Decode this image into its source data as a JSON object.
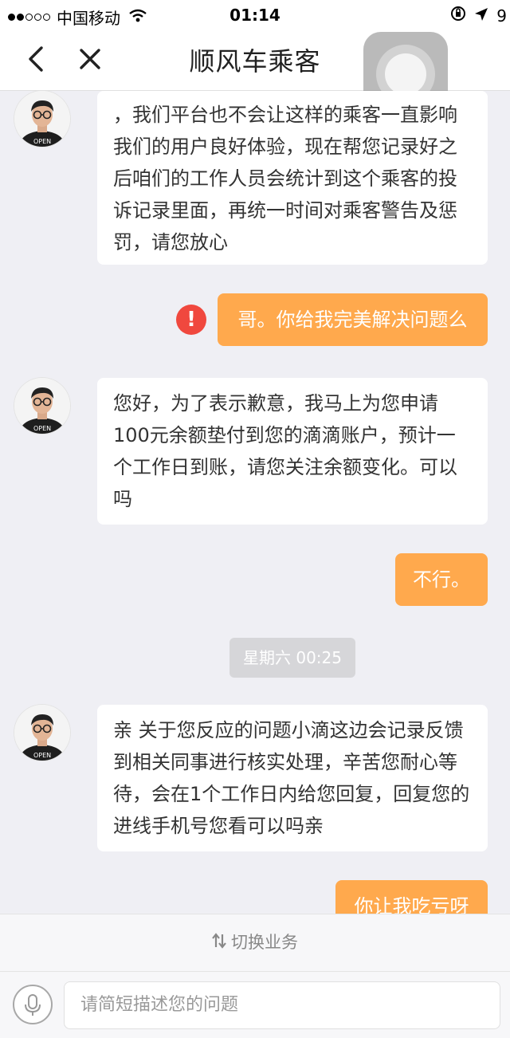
{
  "status_bar": {
    "carrier": "中国移动",
    "time": "01:14",
    "battery_fragment": "9"
  },
  "nav": {
    "title": "顺风车乘客"
  },
  "messages": [
    {
      "sender": "agent",
      "text": "，我们平台也不会让这样的乘客一直影响我们的用户良好体验，现在帮您记录好之后咱们的工作人员会统计到这个乘客的投诉记录里面，再统一时间对乘客警告及惩罚，请您放心"
    },
    {
      "sender": "user",
      "text": "哥。你给我完美解决问题么",
      "status_icon": "!"
    },
    {
      "sender": "agent",
      "text": "您好，为了表示歉意，我马上为您申请100元余额垫付到您的滴滴账户，预计一个工作日到账，请您关注余额变化。可以吗"
    },
    {
      "sender": "user",
      "text": "不行。"
    },
    {
      "sender": "timestamp",
      "text": "星期六 00:25"
    },
    {
      "sender": "agent",
      "text": "亲 关于您反应的问题小滴这边会记录反馈到相关同事进行核实处理，辛苦您耐心等待，会在1个工作日内给您回复，回复您的进线手机号您看可以吗亲"
    },
    {
      "sender": "user",
      "text": "你让我吃亏呀"
    }
  ],
  "bottom": {
    "switch_label": "切换业务",
    "input_placeholder": "请简短描述您的问题"
  },
  "colors": {
    "user_bubble": "#ffa94d",
    "error_icon": "#f0483e",
    "background": "#efeff4"
  },
  "icons": [
    "back-arrow-icon",
    "close-icon",
    "error-icon",
    "switch-icon",
    "microphone-icon",
    "wifi-icon",
    "location-arrow-icon",
    "rotation-lock-icon"
  ]
}
